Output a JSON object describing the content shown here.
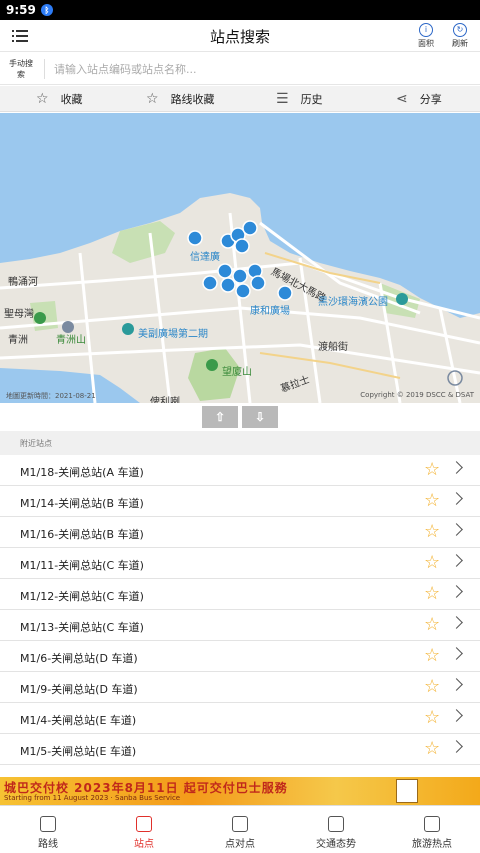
{
  "status_bar": {
    "time": "9:59"
  },
  "header": {
    "title": "站点搜索",
    "right_buttons": [
      {
        "label": "面积",
        "icon": "info-icon"
      },
      {
        "label": "刷新",
        "icon": "refresh-icon"
      }
    ]
  },
  "search": {
    "manual_label": "手动搜索",
    "placeholder": "请输入站点编码或站点名称..."
  },
  "actions": [
    {
      "label": "收藏",
      "icon": "star-outline-icon"
    },
    {
      "label": "路线收藏",
      "icon": "star-outline-icon"
    },
    {
      "label": "历史",
      "icon": "history-icon"
    },
    {
      "label": "分享",
      "icon": "share-icon"
    }
  ],
  "map": {
    "place_labels": [
      "鴨涌河",
      "聖母灣",
      "青洲",
      "青洲山",
      "信達廣",
      "康和廣場",
      "美副廣場第二期",
      "望廈山",
      "俾利喇",
      "馬場北大馬路",
      "黑沙環海濱公園",
      "渡船街",
      "慕拉士"
    ],
    "footer_left": "地圖更新時間：2021-08-21",
    "footer_right": "Copyright © 2019 DSCC & DSAT",
    "colors": {
      "water": "#9bc8ee",
      "land": "#ebe8e2",
      "park": "#c8e0b4",
      "road": "#ffffff",
      "bus_marker": "#2d8ad8"
    }
  },
  "map_controls": {
    "up_label": "⇧",
    "down_label": "⇩"
  },
  "nearby": {
    "header": "附近站点",
    "stops": [
      "M1/18-关闸总站(A 车道)",
      "M1/14-关闸总站(B 车道)",
      "M1/16-关闸总站(B 车道)",
      "M1/11-关闸总站(C 车道)",
      "M1/12-关闸总站(C 车道)",
      "M1/13-关闸总站(C 车道)",
      "M1/6-关闸总站(D 车道)",
      "M1/9-关闸总站(D 车道)",
      "M1/4-关闸总站(E 车道)",
      "M1/5-关闸总站(E 车道)"
    ]
  },
  "ad": {
    "headline": "城巴交付校 2023年8月11日 起可交付巴士服務",
    "subline": "Starting from 11 August 2023 · Sanba Bus Service"
  },
  "bottom_nav": [
    {
      "label": "路线",
      "icon": "bus-icon",
      "active": false
    },
    {
      "label": "站点",
      "icon": "bus-stop-icon",
      "active": true
    },
    {
      "label": "点对点",
      "icon": "map-route-icon",
      "active": false
    },
    {
      "label": "交通态势",
      "icon": "traffic-icon",
      "active": false
    },
    {
      "label": "旅游热点",
      "icon": "camera-icon",
      "active": false
    }
  ]
}
